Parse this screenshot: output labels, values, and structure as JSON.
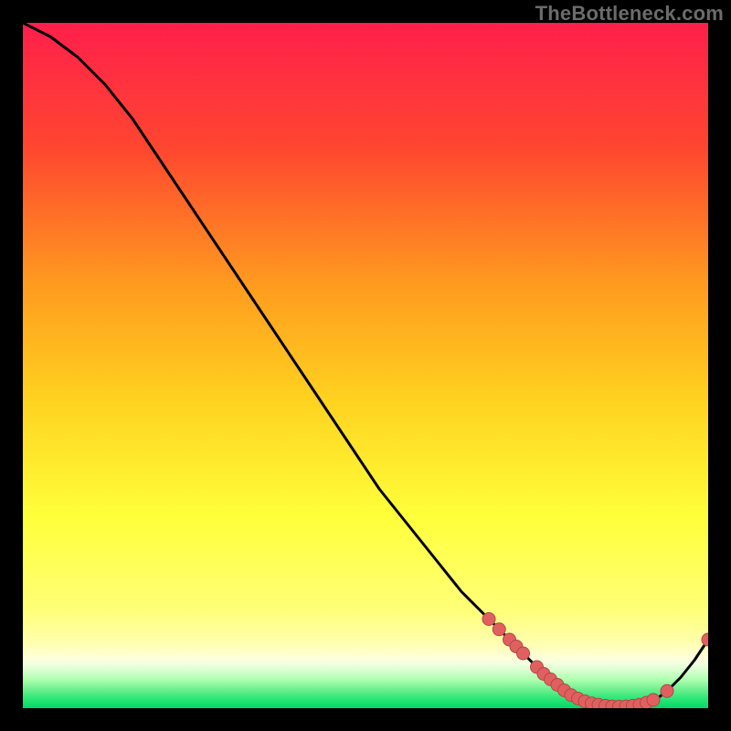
{
  "watermark": "TheBottleneck.com",
  "colors": {
    "bg": "#000000",
    "grad_top": "#ff1f4b",
    "grad_mid_upper": "#ff7a1f",
    "grad_mid": "#ffd21f",
    "grad_mid_lower": "#ffff4a",
    "grad_yellow_pale": "#ffff9a",
    "grad_green_pale": "#c8ffc8",
    "grad_green": "#00e060",
    "line": "#000000",
    "marker_fill": "#e06060",
    "marker_stroke": "#b04848"
  },
  "chart_data": {
    "type": "line",
    "title": "",
    "xlabel": "",
    "ylabel": "",
    "xlim": [
      0,
      100
    ],
    "ylim": [
      0,
      100
    ],
    "series": [
      {
        "name": "curve",
        "x": [
          0,
          4,
          8,
          12,
          16,
          20,
          24,
          28,
          32,
          36,
          40,
          44,
          48,
          52,
          56,
          60,
          64,
          68,
          72,
          74,
          76,
          78,
          80,
          82,
          84,
          86,
          88,
          90,
          92,
          94,
          96,
          98,
          100
        ],
        "y": [
          100,
          98,
          95,
          91,
          86,
          80,
          74,
          68,
          62,
          56,
          50,
          44,
          38,
          32,
          27,
          22,
          17,
          13,
          9,
          7,
          5,
          3,
          1.5,
          0.8,
          0.4,
          0.2,
          0.2,
          0.4,
          1.0,
          2.5,
          4.5,
          7.0,
          10
        ]
      }
    ],
    "markers": {
      "name": "highlight-points",
      "x": [
        68,
        69.5,
        71,
        72,
        73,
        75,
        76,
        77,
        78,
        79,
        80,
        81,
        82,
        83,
        84,
        85,
        86,
        87,
        88,
        89,
        90,
        91,
        92,
        94,
        100
      ],
      "y": [
        13,
        11.5,
        10,
        9,
        8,
        6,
        5,
        4.2,
        3.4,
        2.6,
        1.9,
        1.4,
        1.0,
        0.7,
        0.5,
        0.35,
        0.25,
        0.22,
        0.25,
        0.35,
        0.5,
        0.8,
        1.2,
        2.5,
        10
      ]
    }
  }
}
